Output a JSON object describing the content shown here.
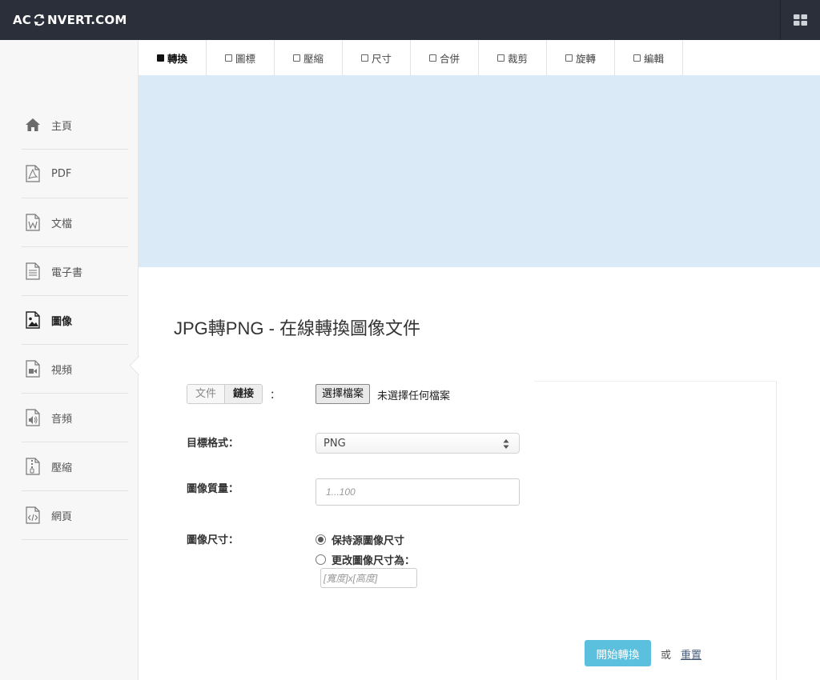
{
  "header": {
    "logo_prefix": "AC",
    "logo_suffix": "NVERT.COM",
    "logo_icon": "sync-icon",
    "menu_icon": "grid-icon"
  },
  "sidebar": {
    "items": [
      {
        "label": "主頁",
        "icon": "home-icon"
      },
      {
        "label": "PDF",
        "icon": "pdf-file-icon"
      },
      {
        "label": "文檔",
        "icon": "word-file-icon"
      },
      {
        "label": "電子書",
        "icon": "document-icon"
      },
      {
        "label": "圖像",
        "icon": "image-file-icon",
        "active": true
      },
      {
        "label": "視頻",
        "icon": "video-file-icon"
      },
      {
        "label": "音頻",
        "icon": "audio-file-icon"
      },
      {
        "label": "壓縮",
        "icon": "zip-file-icon"
      },
      {
        "label": "網頁",
        "icon": "code-file-icon"
      }
    ]
  },
  "tabs": [
    {
      "label": "轉換",
      "active": true
    },
    {
      "label": "圖標"
    },
    {
      "label": "壓縮"
    },
    {
      "label": "尺寸"
    },
    {
      "label": "合併"
    },
    {
      "label": "裁剪"
    },
    {
      "label": "旋轉"
    },
    {
      "label": "編輯"
    }
  ],
  "page": {
    "title": "JPG轉PNG - 在線轉換圖像文件"
  },
  "form": {
    "source_toggle": {
      "file": "文件",
      "link": "鏈接",
      "colon": "："
    },
    "file_button": "選擇檔案",
    "file_status": "未選擇任何檔案",
    "target_format_label": "目標格式：",
    "target_format_value": "PNG",
    "quality_label": "圖像質量：",
    "quality_placeholder": "1...100",
    "size_label": "圖像尺寸：",
    "size_option_keep": "保持源圖像尺寸",
    "size_option_change": "更改圖像尺寸為：",
    "size_placeholder": "[寬度]x[高度]",
    "start_button": "開始轉換",
    "or_text": "或",
    "reset_link": "重置"
  },
  "colors": {
    "navbar": "#2b2f3a",
    "banner": "#daeaf7",
    "accent": "#5bc0de"
  }
}
